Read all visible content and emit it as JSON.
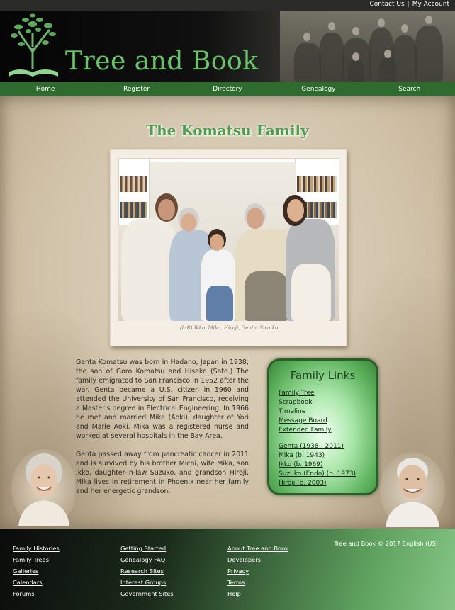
{
  "top_links": {
    "contact": "Contact Us",
    "separator": "|",
    "account": "My Account"
  },
  "brand": {
    "name": "Tree and Book"
  },
  "nav": [
    "Home",
    "Register",
    "Directory",
    "Genealogy",
    "Search"
  ],
  "page": {
    "title": "The Komatsu Family",
    "photo_caption": "(L-R) Ikko, Mika, Hiroji, Genta, Suzuko",
    "bio": [
      "Genta Komatsu was born in Hadano, Japan in 1938; the son of Goro Komatsu and Hisako (Sato.) The family emigrated to San Francisco in 1952 after the war. Genta became a U.S. citizen in 1960 and attended the University of San Francisco, receiving a Master's degree in Electrical Engineering. In 1966 he met and married Mika (Aoki), daughter of Yori and Marie Aoki. Mika was a registered nurse and worked at several hospitals in the Bay Area.",
      "Genta passed away from pancreatic cancer in 2011 and is survived by his brother Michi, wife Mika, son Ikko, daughter-in-law Suzuko, and grandson Hiroji. Mika lives in retirement in Phoenix near her family and her energetic grandson."
    ]
  },
  "family_links": {
    "title": "Family Links",
    "group1": [
      "Family Tree",
      "Scrapbook",
      "Timeline",
      "Message Board",
      "Extended Family"
    ],
    "group2": [
      "Genta (1938 - 2011)",
      "Mika (b. 1943)",
      "Ikko (b. 1969)",
      "Suzuko (Endo) (b. 1973)",
      "Hiroji (b. 2003)"
    ]
  },
  "footer": {
    "col1": [
      "Family Histories",
      "Family Trees",
      "Galleries",
      "Calendars",
      "Forums"
    ],
    "col2": [
      "Getting Started",
      "Genealogy FAQ",
      "Research Sites",
      "Interest Groups",
      "Government Sites"
    ],
    "col3": [
      "About Tree and Book",
      "Developers",
      "Privacy",
      "Terms",
      "Help"
    ],
    "copyright": "Tree and Book © 2017 English (US)"
  },
  "colors": {
    "nav_green": "#2f6a2f",
    "brand_green": "#6fc06f",
    "title_green": "#4f9d4f",
    "box_border": "#2c5e2c"
  },
  "icons": {
    "logo": "tree-on-book-icon"
  }
}
